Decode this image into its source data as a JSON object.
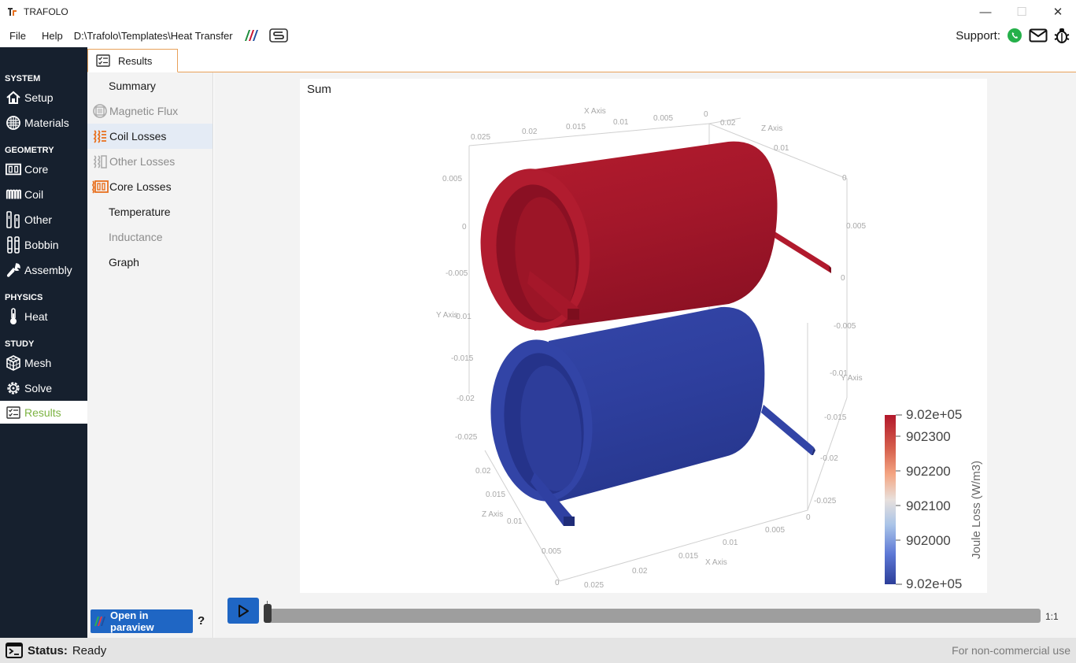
{
  "window": {
    "title": "TRAFOLO",
    "controls": {
      "minimize": "—",
      "maximize": "☐",
      "close": "✕"
    }
  },
  "menubar": {
    "items": [
      "File",
      "Help"
    ],
    "project_path": "D:\\Trafolo\\Templates\\Heat Transfer",
    "support_label": "Support:"
  },
  "tabs": [
    {
      "label": "Results",
      "icon": "checklist-icon"
    }
  ],
  "sidebar": {
    "sections": [
      {
        "title": "SYSTEM",
        "items": [
          {
            "label": "Setup",
            "icon": "home-icon"
          },
          {
            "label": "Materials",
            "icon": "grid-icon"
          }
        ]
      },
      {
        "title": "GEOMETRY",
        "items": [
          {
            "label": "Core",
            "icon": "core-icon"
          },
          {
            "label": "Coil",
            "icon": "coil-icon"
          },
          {
            "label": "Other",
            "icon": "other-icon"
          },
          {
            "label": "Bobbin",
            "icon": "bobbin-icon"
          },
          {
            "label": "Assembly",
            "icon": "wrench-icon"
          }
        ]
      },
      {
        "title": "PHYSICS",
        "items": [
          {
            "label": "Heat",
            "icon": "thermometer-icon"
          }
        ]
      },
      {
        "title": "STUDY",
        "items": [
          {
            "label": "Mesh",
            "icon": "cube-mesh-icon"
          },
          {
            "label": "Solve",
            "icon": "gear-icon"
          },
          {
            "label": "Results",
            "icon": "checklist-icon",
            "active": true
          }
        ]
      }
    ]
  },
  "subnav": {
    "items": [
      {
        "label": "Summary",
        "icon": null,
        "dim": false
      },
      {
        "label": "Magnetic Flux",
        "icon": "magnetic-flux-icon",
        "dim": true
      },
      {
        "label": "Coil Losses",
        "icon": "coil-losses-icon",
        "dim": false,
        "selected": true
      },
      {
        "label": "Other Losses",
        "icon": "other-losses-icon",
        "dim": true
      },
      {
        "label": "Core Losses",
        "icon": "core-losses-icon",
        "dim": false
      },
      {
        "label": "Temperature",
        "icon": null,
        "dim": false
      },
      {
        "label": "Inductance",
        "icon": null,
        "dim": true
      },
      {
        "label": "Graph",
        "icon": null,
        "dim": false
      }
    ],
    "paraview_button": "Open in paraview",
    "help": "?"
  },
  "view": {
    "title": "Sum",
    "axes": {
      "x_title": "X Axis",
      "y_title": "Y Axis",
      "z_title": "Z Axis",
      "x_top_ticks": [
        "0.025",
        "0.02",
        "0.015",
        "0.01",
        "0.005",
        "0"
      ],
      "z_top_ticks": [
        "0.02",
        "0.01",
        "0"
      ],
      "y_left_ticks": [
        "0.005",
        "0",
        "-0.005",
        "-0.01",
        "-0.015",
        "-0.02",
        "-0.025"
      ],
      "z_left_ticks": [
        "0.02",
        "0.015",
        "0.01",
        "0.005",
        "0"
      ],
      "x_bottom_ticks": [
        "0.025",
        "0.02",
        "0.015",
        "0.01",
        "0.005",
        "0"
      ],
      "y_right_ticks": [
        "0.005",
        "0",
        "-0.005",
        "-0.01",
        "-0.015",
        "-0.02",
        "-0.025"
      ]
    },
    "colorbar": {
      "title": "Joule Loss (W/m3)",
      "max_label": "9.02e+05",
      "ticks": [
        "902300",
        "902200",
        "902100",
        "902000"
      ],
      "min_label": "9.02e+05",
      "colors": {
        "high": "#b2182b",
        "mid": "#dddddd",
        "low": "#2c3e99"
      }
    },
    "coil_colors": {
      "top": "#a8142b",
      "bottom": "#2e3fa0"
    }
  },
  "timeline": {
    "ratio": "1:1",
    "position": 0
  },
  "status": {
    "label": "Status:",
    "value": "Ready",
    "license": "For non-commercial use"
  },
  "colors": {
    "sidebar_bg": "#16202e",
    "accent": "#e8a15a",
    "button_blue": "#1f66c4",
    "active_green": "#7cb342"
  }
}
